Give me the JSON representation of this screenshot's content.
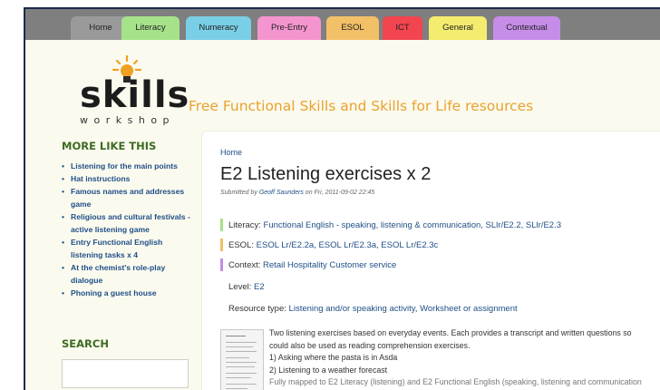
{
  "nav": {
    "tabs": [
      {
        "label": "Home",
        "color": "#9a9a9a"
      },
      {
        "label": "Literacy",
        "color": "#a6e28a"
      },
      {
        "label": "Numeracy",
        "color": "#79cfe6"
      },
      {
        "label": "Pre-Entry",
        "color": "#f595cf"
      },
      {
        "label": "ESOL",
        "color": "#f2c067"
      },
      {
        "label": "ICT",
        "color": "#f2454f"
      },
      {
        "label": "General",
        "color": "#f4ec6e"
      },
      {
        "label": "Contextual",
        "color": "#c58de8"
      }
    ]
  },
  "header": {
    "logo_word": "skills",
    "logo_sub": "workshop",
    "tagline": "Free Functional Skills and Skills for Life resources"
  },
  "sidebar": {
    "title": "MORE LIKE THIS",
    "items": [
      "Listening for the main points",
      "Hat instructions",
      "Famous names and addresses game",
      "Religious and cultural festivals - active listening game",
      "Entry Functional English listening tasks x 4",
      "At the chemist's role-play dialogue",
      "Phoning a guest house"
    ],
    "search_title": "SEARCH"
  },
  "main": {
    "breadcrumb": "Home",
    "title": "E2 Listening exercises x 2",
    "submitted_prefix": "Submitted by",
    "author": "Geoff Saunders",
    "submitted_date": "on Fri, 2011-09-02 22:45",
    "literacy": {
      "label": "Literacy:",
      "value": "Functional English - speaking, listening & communication, SLlr/E2.2, SLlr/E2.3",
      "color": "#a6e28a"
    },
    "esol": {
      "label": "ESOL:",
      "value": "ESOL Lr/E2.2a, ESOL Lr/E2.3a, ESOL Lr/E2.3c",
      "color": "#f2c067"
    },
    "context": {
      "label": "Context:",
      "value": "Retail Hospitality Customer service",
      "color": "#c58de8"
    },
    "level": {
      "label": "Level:",
      "value": "E2"
    },
    "resource_type": {
      "label": "Resource type:",
      "value1": "Listening and/or speaking activity",
      "sep": ",",
      "value2": "Worksheet or assignment"
    },
    "description": [
      "Two listening exercises based on everyday events. Each provides a transcript and written questions so",
      "could also be used as reading comprehension exercises.",
      "1) Asking where the pasta is in Asda",
      "2) Listening to a weather forecast",
      "Fully mapped to E2 Literacy (listening) and E2 Functional English (speaking, listening and communication"
    ]
  }
}
